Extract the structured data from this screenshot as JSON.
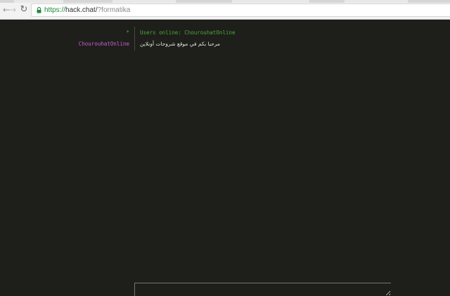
{
  "browser": {
    "nav": {
      "back_glyph": "←",
      "forward_glyph": "→",
      "reload_glyph": "↻"
    },
    "address_bar": {
      "scheme": "https://",
      "host": "hack.chat/",
      "query": "?formatika"
    }
  },
  "chat": {
    "messages": [
      {
        "nick": "*",
        "text": "Users online: ChourouhatOnline",
        "kind": "system"
      },
      {
        "nick": "ChourouhatOnline",
        "text": "مرحبا بكم في موقع شروحات أونلاين",
        "kind": "user"
      }
    ],
    "input": {
      "value": ""
    }
  },
  "colors": {
    "background": "#1e1e1a",
    "system_green": "#4caa3c",
    "nick_purple": "#c95ed9",
    "text_light": "#e6e6e0",
    "secure_green": "#1e8a3a"
  }
}
